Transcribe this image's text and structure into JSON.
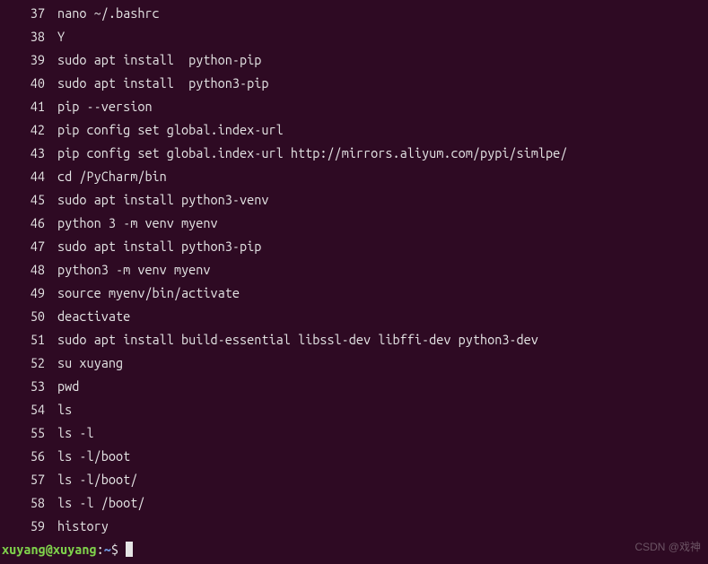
{
  "history": [
    {
      "n": 37,
      "cmd": "nano ~/.bashrc"
    },
    {
      "n": 38,
      "cmd": "Y"
    },
    {
      "n": 39,
      "cmd": "sudo apt install  python-pip"
    },
    {
      "n": 40,
      "cmd": "sudo apt install  python3-pip"
    },
    {
      "n": 41,
      "cmd": "pip --version"
    },
    {
      "n": 42,
      "cmd": "pip config set global.index-url"
    },
    {
      "n": 43,
      "cmd": "pip config set global.index-url http://mirrors.aliyum.com/pypi/simlpe/"
    },
    {
      "n": 44,
      "cmd": "cd /PyCharm/bin"
    },
    {
      "n": 45,
      "cmd": "sudo apt install python3-venv"
    },
    {
      "n": 46,
      "cmd": "python 3 -m venv myenv"
    },
    {
      "n": 47,
      "cmd": "sudo apt install python3-pip"
    },
    {
      "n": 48,
      "cmd": "python3 -m venv myenv"
    },
    {
      "n": 49,
      "cmd": "source myenv/bin/activate"
    },
    {
      "n": 50,
      "cmd": "deactivate"
    },
    {
      "n": 51,
      "cmd": "sudo apt install build-essential libssl-dev libffi-dev python3-dev"
    },
    {
      "n": 52,
      "cmd": "su xuyang"
    },
    {
      "n": 53,
      "cmd": "pwd"
    },
    {
      "n": 54,
      "cmd": "ls"
    },
    {
      "n": 55,
      "cmd": "ls -l"
    },
    {
      "n": 56,
      "cmd": "ls -l/boot"
    },
    {
      "n": 57,
      "cmd": "ls -l/boot/"
    },
    {
      "n": 58,
      "cmd": "ls -l /boot/"
    },
    {
      "n": 59,
      "cmd": "history"
    }
  ],
  "prompt": {
    "user": "xuyang@xuyang",
    "colon": ":",
    "path": "~",
    "dollar": "$ "
  },
  "watermark": "CSDN @戏神"
}
